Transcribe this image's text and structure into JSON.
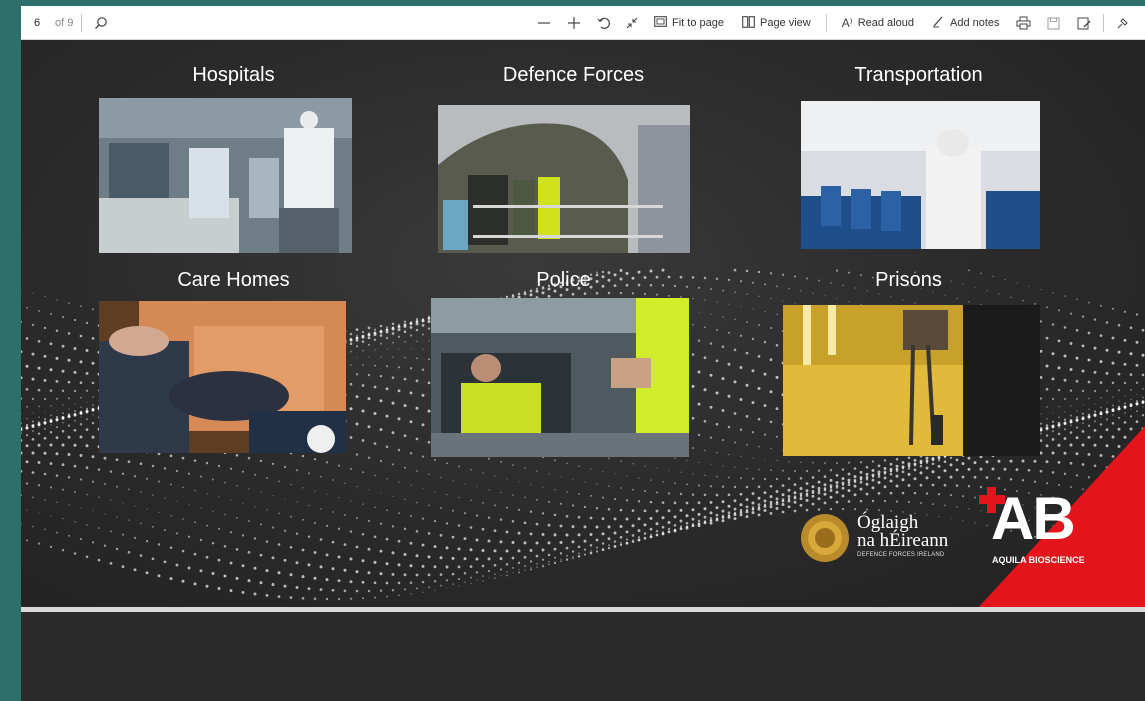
{
  "toolbar": {
    "page_current": "6",
    "page_total": "of 9",
    "fit_to_page": "Fit to page",
    "page_view": "Page view",
    "read_aloud": "Read aloud",
    "add_notes": "Add notes"
  },
  "slide": {
    "captions": [
      "Hospitals",
      "Defence Forces",
      "Transportation",
      "Care Homes",
      "Police",
      "Prisons"
    ],
    "logos": {
      "defence_line1": "Óglaigh",
      "defence_line2": "na hÉireann",
      "defence_sub": "DEFENCE FORCES IRELAND",
      "ab_text": "AB",
      "ab_sub": "AQUILA BIOSCIENCE"
    },
    "colors": {
      "accent_red": "#e3141b",
      "background": "#2b2b2b",
      "teal_frame": "#2f6f6b"
    }
  },
  "icons": [
    "search-icon",
    "zoom-out-icon",
    "zoom-in-icon",
    "rotate-icon",
    "collapse-icon",
    "fit-page-icon",
    "page-view-icon",
    "read-aloud-icon",
    "add-notes-icon",
    "print-icon",
    "save-icon",
    "save-as-icon",
    "pin-icon"
  ]
}
